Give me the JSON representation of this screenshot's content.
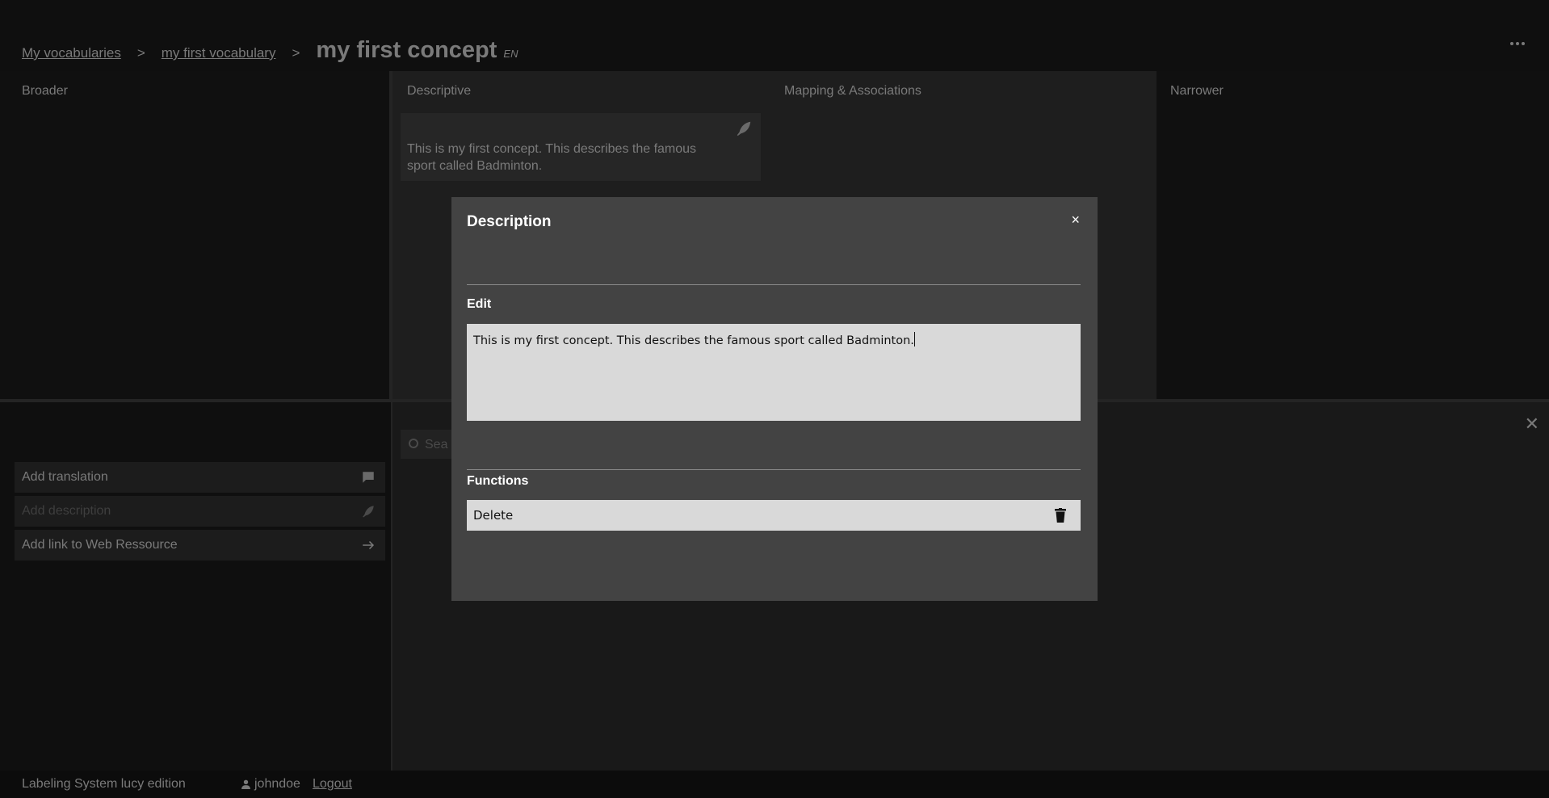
{
  "breadcrumb": {
    "items": [
      "My vocabularies",
      "my first vocabulary"
    ],
    "separator": ">",
    "current": "my first concept",
    "language": "EN"
  },
  "columns": {
    "broader": "Broader",
    "descriptive": "Descriptive",
    "mapping": "Mapping & Associations",
    "narrower": "Narrower"
  },
  "description_card": {
    "text": "This is my first concept. This describes the famous sport called Badminton."
  },
  "actions": [
    {
      "label": "Add translation",
      "icon": "speech-bubble-icon"
    },
    {
      "label": "Add description",
      "icon": "feather-icon"
    },
    {
      "label": "Add link to Web Ressource",
      "icon": "arrow-right-icon"
    }
  ],
  "search": {
    "placeholder": "Sea"
  },
  "footer": {
    "brand": "Labeling System lucy edition",
    "user": "johndoe",
    "logout": "Logout"
  },
  "modal": {
    "title": "Description",
    "close": "×",
    "edit_label": "Edit",
    "edit_value": "This is my first concept. This describes the famous sport called Badminton.",
    "functions_label": "Functions",
    "delete_label": "Delete"
  },
  "colors": {
    "modal_bg": "#434343",
    "field_bg": "#d9d9d9",
    "overlay_text": "#7a7a7a"
  }
}
